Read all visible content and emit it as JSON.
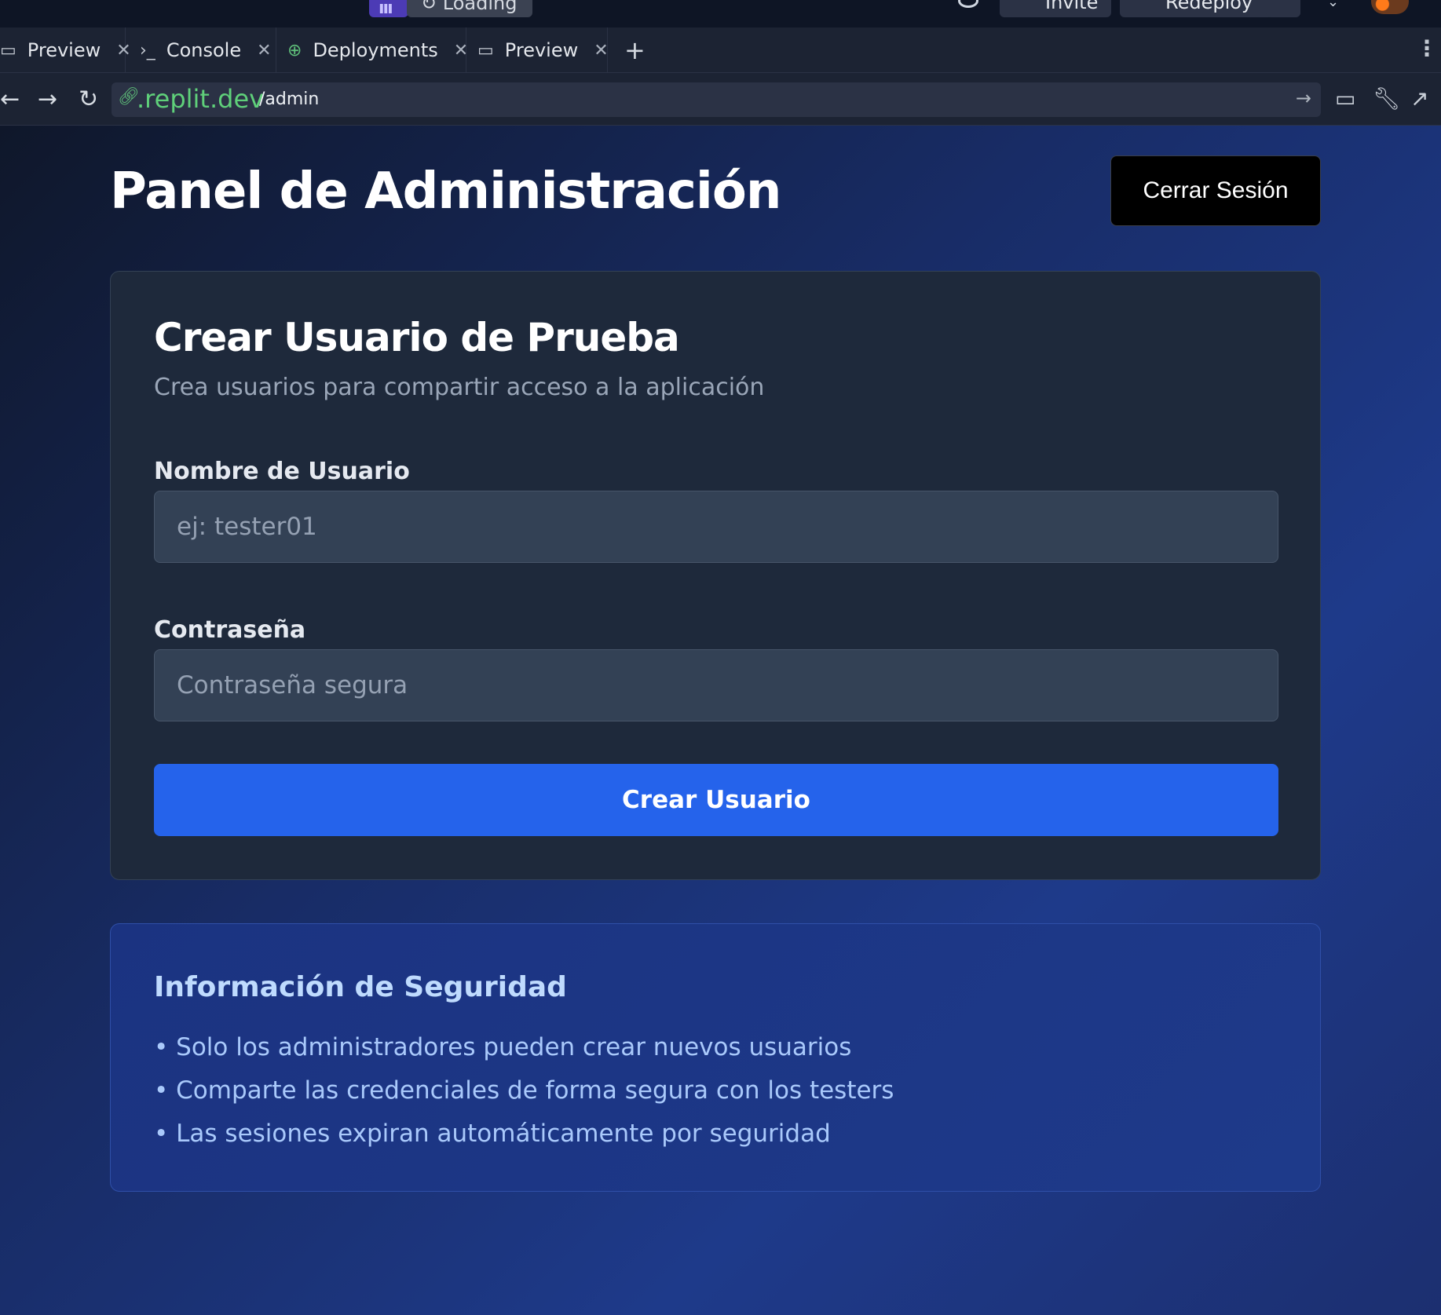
{
  "topbar": {
    "loading_label": "Loading",
    "invite_label": "Invite",
    "redeploy_label": "Redeploy"
  },
  "tabs": [
    {
      "label": "Preview",
      "icon": "monitor-icon"
    },
    {
      "label": "Console",
      "icon": "terminal-icon"
    },
    {
      "label": "Deployments",
      "icon": "deployments-icon"
    },
    {
      "label": "Preview",
      "icon": "monitor-icon"
    }
  ],
  "address": {
    "domain": ".replit.dev",
    "path": "/admin"
  },
  "page": {
    "title": "Panel de Administración",
    "logout_label": "Cerrar Sesión"
  },
  "form": {
    "title": "Crear Usuario de Prueba",
    "subtitle": "Crea usuarios para compartir acceso a la aplicación",
    "username_label": "Nombre de Usuario",
    "username_placeholder": "ej: tester01",
    "username_value": "",
    "password_label": "Contraseña",
    "password_placeholder": "Contraseña segura",
    "password_value": "",
    "submit_label": "Crear Usuario"
  },
  "security": {
    "title": "Información de Seguridad",
    "items": [
      "• Solo los administradores pueden crear nuevos usuarios",
      "• Comparte las credenciales de forma segura con los testers",
      "• Las sesiones expiran automáticamente por seguridad"
    ]
  },
  "colors": {
    "accent": "#2563eb",
    "card_bg": "#1e293b",
    "info_bg": "#1e3a8a",
    "url_green": "#5fd07a"
  }
}
